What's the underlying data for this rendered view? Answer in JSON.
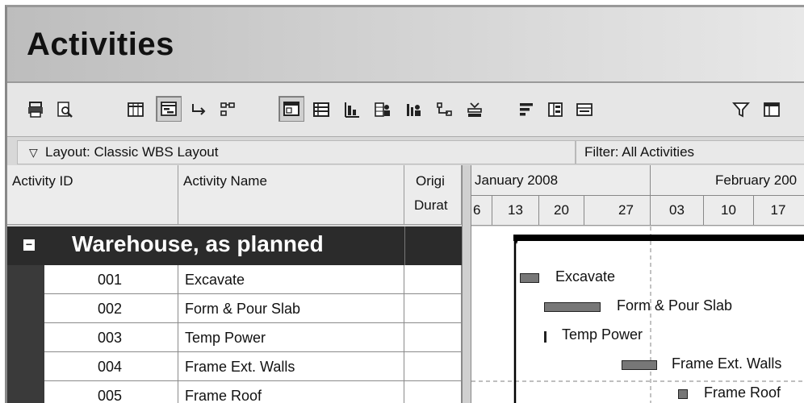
{
  "window": {
    "title": "Activities"
  },
  "toolbar": {
    "buttons": [
      "print-icon",
      "print-preview-icon",
      "columns-icon",
      "bars-icon",
      "relationship-icon",
      "wbs-icon",
      "activity-table-icon",
      "activity-details-icon",
      "gantt-chart-icon",
      "activity-usage-icon",
      "resource-usage-icon",
      "trace-logic-icon",
      "progress-icon",
      "sort-icon",
      "group-icon",
      "timescale-icon",
      "filter-icon",
      "layout-icon"
    ]
  },
  "layout_bar": {
    "caret": "▽",
    "label": "Layout: Classic WBS Layout"
  },
  "filter_bar": {
    "label": "Filter: All Activities"
  },
  "columns": {
    "activity_id": "Activity ID",
    "activity_name": "Activity Name",
    "orig_dur_line1": "Origi",
    "orig_dur_line2": "Durat"
  },
  "timescale": {
    "months": [
      "January 2008",
      "February 200"
    ],
    "weeks": [
      "6",
      "13",
      "20",
      "27",
      "03",
      "10",
      "17"
    ]
  },
  "wbs": {
    "expander": "−",
    "name": "Warehouse, as planned"
  },
  "activities": [
    {
      "id": "001",
      "name": "Excavate",
      "orig_dur": "",
      "bar_label": "Excavate"
    },
    {
      "id": "002",
      "name": "Form & Pour Slab",
      "orig_dur": "",
      "bar_label": "Form & Pour Slab"
    },
    {
      "id": "003",
      "name": "Temp Power",
      "orig_dur": "",
      "bar_label": "Temp Power"
    },
    {
      "id": "004",
      "name": "Frame Ext. Walls",
      "orig_dur": "",
      "bar_label": "Frame Ext. Walls"
    },
    {
      "id": "005",
      "name": "Frame Roof",
      "orig_dur": "",
      "bar_label": "Frame Roof"
    }
  ],
  "colors": {
    "title_gradient_start": "#bdbdbd",
    "wbs_band": "#2b2b2b",
    "bar_fill": "#777777",
    "summary_bar": "#000000"
  }
}
